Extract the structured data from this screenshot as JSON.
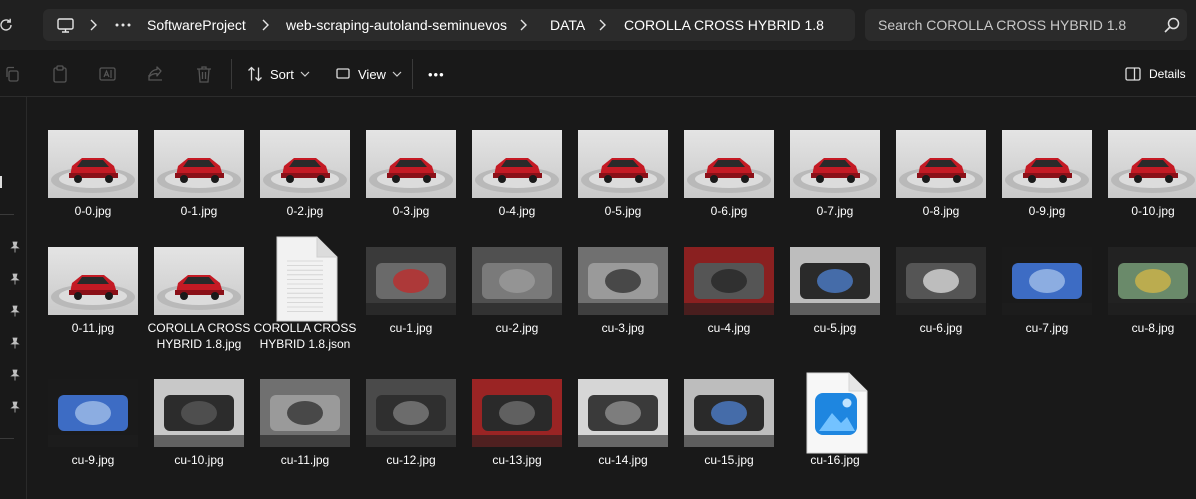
{
  "address_bar": {
    "breadcrumbs": [
      "SoftwareProject",
      "web-scraping-autoland-seminuevos",
      "DATA",
      "COROLLA CROSS HYBRID 1.8"
    ],
    "search_placeholder": "Search COROLLA CROSS HYBRID 1.8"
  },
  "command_bar": {
    "sort_label": "Sort",
    "view_label": "View",
    "more_label": "•••",
    "details_label": "Details"
  },
  "files": [
    {
      "name": "0-0.jpg",
      "kind": "studio"
    },
    {
      "name": "0-1.jpg",
      "kind": "studio"
    },
    {
      "name": "0-2.jpg",
      "kind": "studio"
    },
    {
      "name": "0-3.jpg",
      "kind": "studio"
    },
    {
      "name": "0-4.jpg",
      "kind": "studio"
    },
    {
      "name": "0-5.jpg",
      "kind": "studio"
    },
    {
      "name": "0-6.jpg",
      "kind": "studio"
    },
    {
      "name": "0-7.jpg",
      "kind": "studio"
    },
    {
      "name": "0-8.jpg",
      "kind": "studio"
    },
    {
      "name": "0-9.jpg",
      "kind": "studio"
    },
    {
      "name": "0-10.jpg",
      "kind": "studio"
    },
    {
      "name": "0-11.jpg",
      "kind": "studio"
    },
    {
      "name": "COROLLA CROSS HYBRID 1.8.jpg",
      "kind": "studio"
    },
    {
      "name": "COROLLA CROSS HYBRID 1.8.json",
      "kind": "document"
    },
    {
      "name": "cu-1.jpg",
      "kind": "engine"
    },
    {
      "name": "cu-2.jpg",
      "kind": "door"
    },
    {
      "name": "cu-3.jpg",
      "kind": "seat-gray"
    },
    {
      "name": "cu-4.jpg",
      "kind": "cabin-red"
    },
    {
      "name": "cu-5.jpg",
      "kind": "steering"
    },
    {
      "name": "cu-6.jpg",
      "kind": "gauges"
    },
    {
      "name": "cu-7.jpg",
      "kind": "screen"
    },
    {
      "name": "cu-8.jpg",
      "kind": "camera"
    },
    {
      "name": "cu-9.jpg",
      "kind": "screen"
    },
    {
      "name": "cu-10.jpg",
      "kind": "console"
    },
    {
      "name": "cu-11.jpg",
      "kind": "seat-gray"
    },
    {
      "name": "cu-12.jpg",
      "kind": "rear-seat"
    },
    {
      "name": "cu-13.jpg",
      "kind": "trunk"
    },
    {
      "name": "cu-14.jpg",
      "kind": "spare"
    },
    {
      "name": "cu-15.jpg",
      "kind": "steering"
    },
    {
      "name": "cu-16.jpg",
      "kind": "image-file"
    }
  ]
}
